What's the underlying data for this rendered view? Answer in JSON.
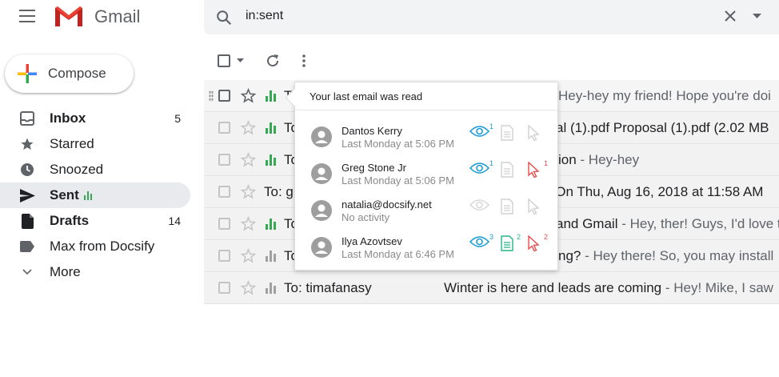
{
  "header": {
    "app_name": "Gmail",
    "search_query": "in:sent"
  },
  "sidebar": {
    "compose_label": "Compose",
    "items": [
      {
        "label": "Inbox",
        "count": "5",
        "icon": "inbox-icon",
        "bold": true
      },
      {
        "label": "Starred",
        "count": "",
        "icon": "star-icon"
      },
      {
        "label": "Snoozed",
        "count": "",
        "icon": "clock-icon"
      },
      {
        "label": "Sent",
        "count": "",
        "icon": "send-icon",
        "active": true,
        "bold": true
      },
      {
        "label": "Drafts",
        "count": "14",
        "icon": "draft-icon",
        "bold": true
      },
      {
        "label": "Max from Docsify",
        "count": "",
        "icon": "label-icon"
      },
      {
        "label": "More",
        "count": "",
        "icon": "chevron-down-icon"
      }
    ]
  },
  "emails": [
    {
      "sender": "T",
      "subject": "",
      "snippet": "Hey-hey my friend! Hope you're doi",
      "tracked": true,
      "read": true
    },
    {
      "sender": "To",
      "subject": "al (1).pdf Proposal (1).pdf (2.02 MB",
      "snippet": "",
      "tracked": true,
      "read": true
    },
    {
      "sender": "To",
      "subject": "ion",
      "snippet": " - Hey-hey",
      "tracked": true,
      "read": true
    },
    {
      "sender": "To: g",
      "subject": "s On Thu, Aug 16, 2018 at 11:58 AM",
      "snippet": "",
      "tracked": false,
      "read": false
    },
    {
      "sender": "To",
      "subject": "and Gmail",
      "snippet": " - Hey, ther! Guys, I'd love t",
      "tracked": true,
      "read": true
    },
    {
      "sender": "To",
      "subject": "ng?",
      "snippet": " - Hey there! So, you may install",
      "tracked": true,
      "read": false
    },
    {
      "sender": "To: timafanasy",
      "subject": "Winter is here and leads are coming",
      "snippet": " - Hey! Mike, I saw",
      "tracked": true,
      "read": false
    }
  ],
  "popup": {
    "title": "Your last email was read",
    "recipients": [
      {
        "name": "Dantos Kerry",
        "time": "Last Monday at 5:06 PM",
        "opens": "1",
        "attachments": "",
        "clicks": ""
      },
      {
        "name": "Greg Stone Jr",
        "time": "Last Monday at 5:06 PM",
        "opens": "1",
        "attachments": "",
        "clicks": "1"
      },
      {
        "name": "natalia@docsify.net",
        "time": "No activity",
        "opens": "",
        "attachments": "",
        "clicks": ""
      },
      {
        "name": "Ilya Azovtsev",
        "time": "Last Monday at 6:46 PM",
        "opens": "3",
        "attachments": "2",
        "clicks": "2"
      }
    ]
  },
  "colors": {
    "open": "#1a9bd7",
    "attachment": "#25b585",
    "click": "#ea4a4a",
    "inactive": "#d0d0d0",
    "tracked_bar": "#34a853",
    "untracked_bar": "#a0a0a0"
  }
}
